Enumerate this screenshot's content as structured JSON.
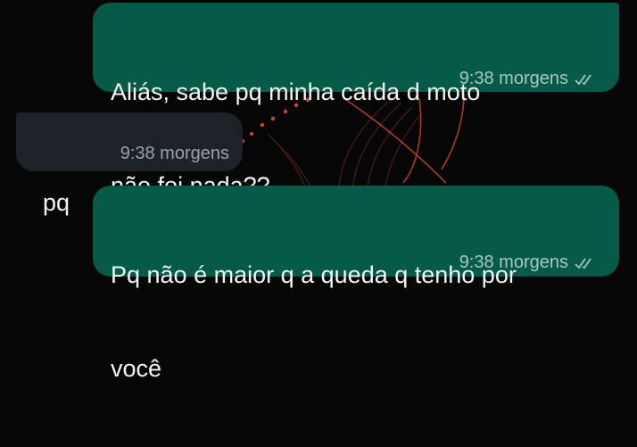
{
  "chat": {
    "messages": [
      {
        "direction": "outgoing",
        "lines": [
          "Aliás, sabe pq minha caída d moto",
          "não foi nada??"
        ],
        "time": "9:38 morgens",
        "status_icon": "double-check-icon"
      },
      {
        "direction": "incoming",
        "lines": [
          "pq"
        ],
        "time": "9:38 morgens"
      },
      {
        "direction": "outgoing",
        "lines": [
          "Pq não é maior q a queda q tenho por",
          "você"
        ],
        "time": "9:38 morgens",
        "status_icon": "double-check-icon"
      }
    ]
  },
  "colors": {
    "background": "#060606",
    "outgoing_bubble": "#065a48",
    "incoming_bubble": "#1c2227",
    "text": "#f2f5f4",
    "meta_outgoing": "#a9c7bf",
    "meta_incoming": "#9aa3a8",
    "wallpaper_accent": "#d0472f"
  }
}
